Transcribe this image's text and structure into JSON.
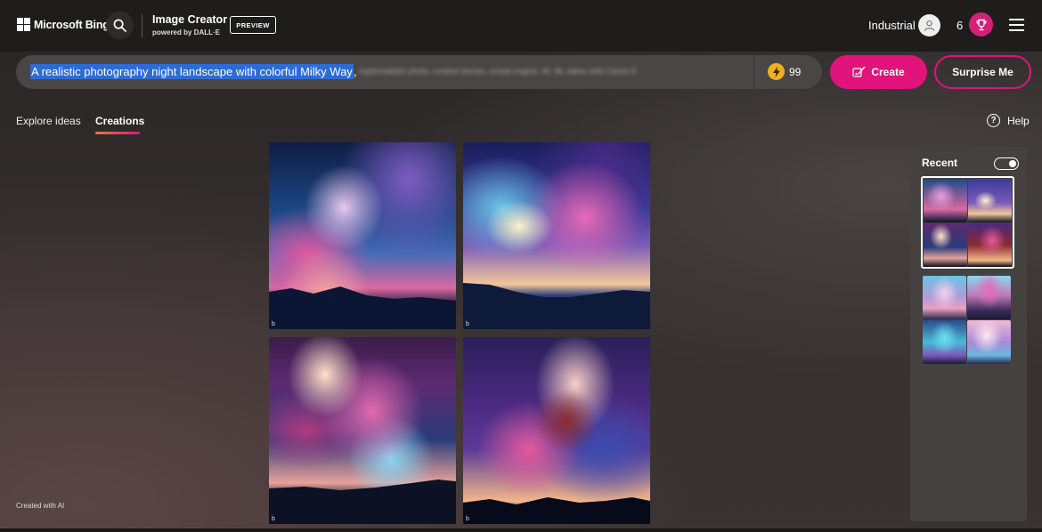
{
  "header": {
    "brand": "Microsoft Bing",
    "app_title": "Image Creator",
    "app_subtitle": "powered by DALL·E",
    "badge": "PREVIEW",
    "user_name": "Industrial",
    "reward_count": "6"
  },
  "prompt": {
    "selected_text": "A realistic photography night landscape with colorful Milky Way",
    "trailing_comma": ",",
    "blurred_text": "hyperrealistic photo, contest winner, unreal engine, 4k, 8k, taken with Canon E",
    "boosts": "99"
  },
  "actions": {
    "create_label": "Create",
    "surprise_label": "Surprise Me"
  },
  "tabs": [
    {
      "label": "Explore ideas",
      "active": false
    },
    {
      "label": "Creations",
      "active": true
    }
  ],
  "help_label": "Help",
  "images": [
    {
      "watermark": "b"
    },
    {
      "watermark": "b"
    },
    {
      "watermark": "b"
    },
    {
      "watermark": "b"
    }
  ],
  "recent": {
    "title": "Recent",
    "toggle_on": true
  },
  "footer_note": "Created with AI",
  "colors": {
    "accent": "#e0147a",
    "boost": "#f0b020",
    "selection": "#2d6bd6"
  }
}
